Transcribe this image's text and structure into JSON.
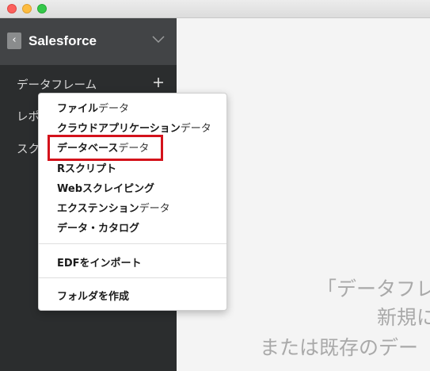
{
  "titlebar": {
    "buttons": [
      "close",
      "minimize",
      "zoom"
    ],
    "colors": {
      "close": "#fc605c",
      "minimize": "#fdbc40",
      "zoom": "#34c84a"
    }
  },
  "sidebar": {
    "back_icon": "chevron-left-icon",
    "title": "Salesforce",
    "collapse_icon": "chevron-down-icon",
    "items": [
      {
        "label": "データフレーム",
        "action_icon": "plus-icon"
      },
      {
        "label": "レポ"
      },
      {
        "label": "スク"
      }
    ],
    "background": "#2b2d2e",
    "header_background": "#424446"
  },
  "context_menu": {
    "items": [
      {
        "bold": "ファイル",
        "normal": "データ"
      },
      {
        "bold": "クラウドアプリケーション",
        "normal": "データ"
      },
      {
        "bold": "データベース",
        "normal": "データ"
      },
      {
        "bold": "Rスクリプト",
        "normal": ""
      },
      {
        "bold": "Webスクレイピング",
        "normal": ""
      },
      {
        "bold": "エクステンション",
        "normal": "データ"
      },
      {
        "bold": "データ・カタログ",
        "normal": ""
      },
      {
        "bold": "EDFをインポート",
        "normal": ""
      },
      {
        "bold": "フォルダを作成",
        "normal": ""
      }
    ],
    "highlight_color": "#d4121b"
  },
  "main": {
    "empty_lines": [
      "「データフレ",
      "新規に",
      "または既存のデー"
    ]
  }
}
